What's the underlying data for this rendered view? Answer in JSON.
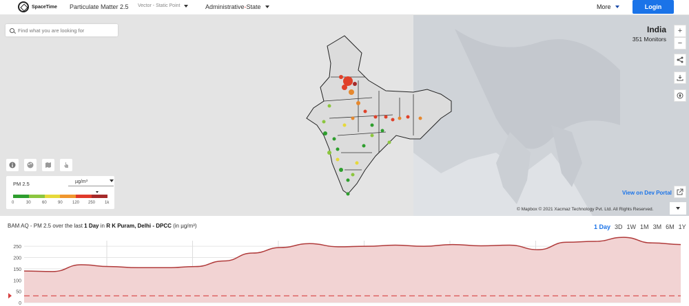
{
  "header": {
    "brand": "SpaceTime",
    "dataset": "Particulate Matter 2.5",
    "layer_type": "Vector - Static Point",
    "boundary_main": "Administrative",
    "boundary_sep": " - ",
    "boundary_sub": "State",
    "more_label": "More",
    "login_label": "Login"
  },
  "map": {
    "search_placeholder": "Find what you are looking for",
    "country_name": "India",
    "monitor_count": "351 Monitors",
    "zoom_in": "+",
    "zoom_out": "−",
    "dev_portal": "View on Dev Portal",
    "attribution": "© Mapbox   © 2021 Xacmaz Technology Pvt. Ltd. All Rights Reserved."
  },
  "legend": {
    "title": "PM 2.5",
    "unit": "µg/m³",
    "ticks": [
      "0",
      "30",
      "60",
      "90",
      "120",
      "250",
      "1k"
    ],
    "colors": [
      "#2e9e2e",
      "#8cc63f",
      "#e6d93a",
      "#f0962e",
      "#e03a2a",
      "#a52a2a"
    ]
  },
  "chart_header": {
    "prefix": "BAM AQ - PM 2.5 over the last ",
    "period": "1 Day",
    "mid": " in ",
    "location": "R K Puram, Delhi - DPCC",
    "unit_note": " (in µg/m³)"
  },
  "range_tabs": [
    "1 Day",
    "3D",
    "1W",
    "1M",
    "3M",
    "6M",
    "1Y"
  ],
  "chart_data": {
    "type": "area",
    "y_ticks": [
      "250",
      "200",
      "150",
      "100",
      "50",
      "0"
    ],
    "ylim": [
      0,
      275
    ],
    "series": [
      {
        "values": [
          140,
          138,
          168,
          160,
          155,
          155,
          160,
          185,
          220,
          245,
          262,
          248,
          250,
          255,
          250,
          258,
          252,
          255,
          235,
          268,
          272,
          290,
          265,
          258
        ]
      }
    ],
    "threshold": 30,
    "line_color": "#b03a3a",
    "fill_color": "#f2d3d3"
  }
}
